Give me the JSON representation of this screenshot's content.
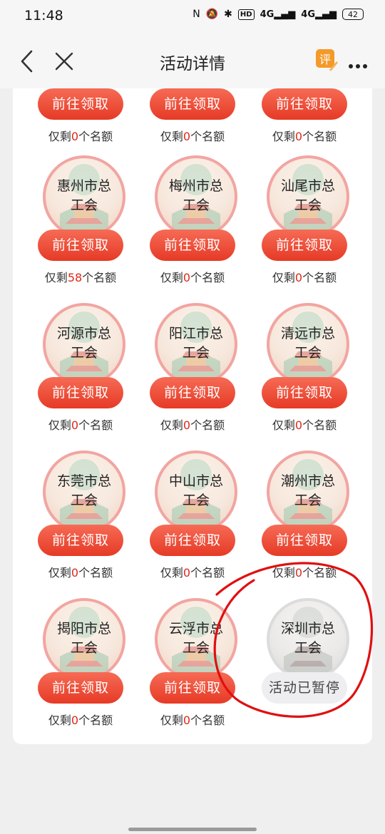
{
  "status_bar": {
    "time": "11:48",
    "hd": "HD",
    "sig1": "4G",
    "sig2": "4G",
    "battery": "42"
  },
  "nav": {
    "title": "活动详情",
    "review_icon": "评"
  },
  "quota_prefix": "仅剩",
  "quota_suffix": "个名额",
  "top_row": [
    {
      "button": "前往领取",
      "remaining": "0"
    },
    {
      "button": "前往领取",
      "remaining": "0"
    },
    {
      "button": "前往领取",
      "remaining": "0"
    }
  ],
  "items": [
    {
      "name_line1": "惠州市总",
      "name_line2": "工会",
      "button": "前往领取",
      "remaining": "58"
    },
    {
      "name_line1": "梅州市总",
      "name_line2": "工会",
      "button": "前往领取",
      "remaining": "0"
    },
    {
      "name_line1": "汕尾市总",
      "name_line2": "工会",
      "button": "前往领取",
      "remaining": "0"
    },
    {
      "name_line1": "河源市总",
      "name_line2": "工会",
      "button": "前往领取",
      "remaining": "0"
    },
    {
      "name_line1": "阳江市总",
      "name_line2": "工会",
      "button": "前往领取",
      "remaining": "0"
    },
    {
      "name_line1": "清远市总",
      "name_line2": "工会",
      "button": "前往领取",
      "remaining": "0"
    },
    {
      "name_line1": "东莞市总",
      "name_line2": "工会",
      "button": "前往领取",
      "remaining": "0"
    },
    {
      "name_line1": "中山市总",
      "name_line2": "工会",
      "button": "前往领取",
      "remaining": "0"
    },
    {
      "name_line1": "潮州市总",
      "name_line2": "工会",
      "button": "前往领取",
      "remaining": "0"
    },
    {
      "name_line1": "揭阳市总",
      "name_line2": "工会",
      "button": "前往领取",
      "remaining": "0"
    },
    {
      "name_line1": "云浮市总",
      "name_line2": "工会",
      "button": "前往领取",
      "remaining": "0"
    },
    {
      "name_line1": "深圳市总",
      "name_line2": "工会",
      "button": "活动已暂停",
      "remaining": null,
      "paused": true
    }
  ],
  "colors": {
    "accent_red": "#e63a26",
    "quota_number": "#e0271b",
    "annotation": "#e01010"
  }
}
